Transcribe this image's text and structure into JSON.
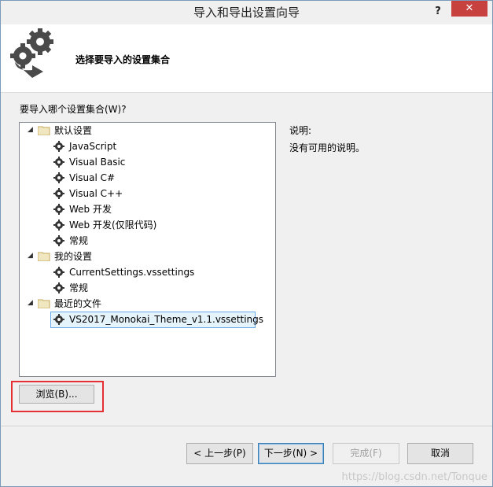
{
  "window": {
    "title": "导入和导出设置向导",
    "help_label": "?",
    "close_label": "✕"
  },
  "header": {
    "title": "选择要导入的设置集合"
  },
  "question": "要导入哪个设置集合(W)?",
  "tree": {
    "groups": [
      {
        "label": "默认设置",
        "expanded": true,
        "items": [
          "JavaScript",
          "Visual Basic",
          "Visual C#",
          "Visual C++",
          "Web 开发",
          "Web 开发(仅限代码)",
          "常规"
        ]
      },
      {
        "label": "我的设置",
        "expanded": true,
        "items": [
          "CurrentSettings.vssettings",
          "常规"
        ]
      },
      {
        "label": "最近的文件",
        "expanded": true,
        "items": [
          "VS2017_Monokai_Theme_v1.1.vssettings"
        ]
      }
    ],
    "selected_item": "VS2017_Monokai_Theme_v1.1.vssettings"
  },
  "description": {
    "label": "说明:",
    "text": "没有可用的说明。"
  },
  "buttons": {
    "browse": "浏览(B)...",
    "prev": "< 上一步(P)",
    "next": "下一步(N) >",
    "finish": "完成(F)",
    "cancel": "取消"
  },
  "watermark": "https://blog.csdn.net/Tonque",
  "colors": {
    "close_button": "#c7423f",
    "highlight_box": "#e43034",
    "selection_border": "#66a7e8"
  }
}
